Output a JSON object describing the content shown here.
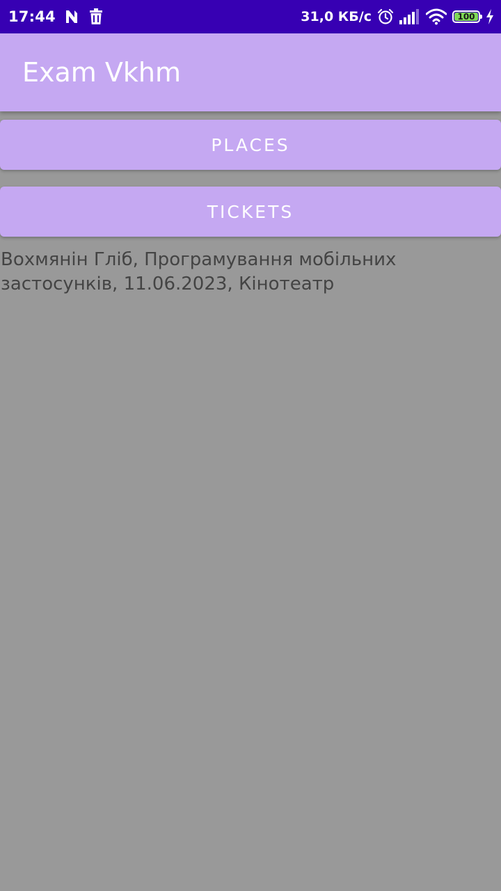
{
  "status_bar": {
    "time": "17:44",
    "network_speed": "31,0 КБ/с",
    "battery_level": "100",
    "battery_fraction": 1.0,
    "icons": [
      "n-notification-icon",
      "trash-icon",
      "alarm-icon",
      "signal-icon",
      "wifi-icon",
      "battery-icon",
      "charging-icon"
    ]
  },
  "app_bar": {
    "title": "Exam Vkhm"
  },
  "buttons": {
    "places": "PLACES",
    "tickets": "TICKETS"
  },
  "info": {
    "text": "Вохмянін Гліб, Програмування мобільних застосунків, 11.06.2023, Кінотеатр"
  },
  "colors": {
    "status_bar": "#3700B3",
    "primary": "#C5A8F2",
    "background": "#999999",
    "text": "#444444"
  }
}
